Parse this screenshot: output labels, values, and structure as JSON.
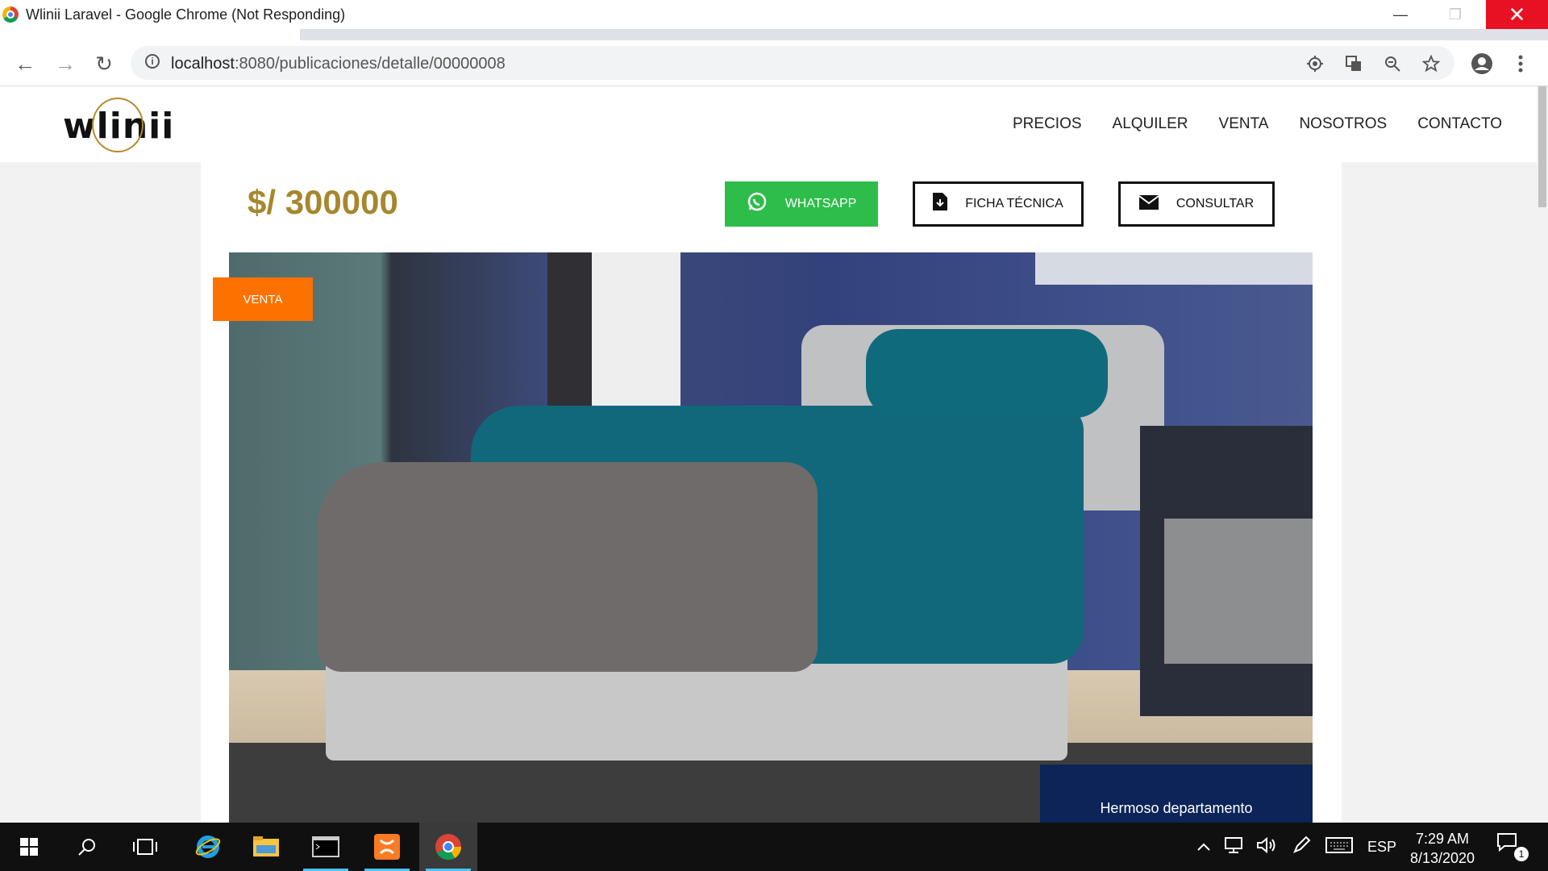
{
  "window": {
    "title": "Wlinii Laravel - Google Chrome (Not Responding)",
    "minimize_glyph": "—",
    "maximize_glyph": "❐",
    "close_glyph": "✕"
  },
  "browser": {
    "back_glyph": "←",
    "forward_glyph": "→",
    "reload_glyph": "↻",
    "info_glyph": "i",
    "url_host": "localhost",
    "url_path": ":8080/publicaciones/detalle/00000008",
    "icons": [
      "location-icon",
      "translate-icon",
      "zoom-icon",
      "star-icon",
      "profile-icon",
      "menu-icon"
    ]
  },
  "site": {
    "logo_text": "wlinii",
    "nav": [
      "PRECIOS",
      "ALQUILER",
      "VENTA",
      "NOSOTROS",
      "CONTACTO"
    ]
  },
  "listing": {
    "price": "$/ 300000",
    "buttons": {
      "whatsapp": "WHATSAPP",
      "ficha": "FICHA TÉCNICA",
      "consultar": "CONSULTAR"
    },
    "badge": "VENTA",
    "caption": "Hermoso departamento"
  },
  "taskbar": {
    "language": "ESP",
    "time": "7:29 AM",
    "date": "8/13/2020",
    "notification_count": "1"
  },
  "colors": {
    "price": "#a6872e",
    "whatsapp": "#2ebd4a",
    "badge": "#fc7100",
    "caption_bg": "#0c2457",
    "close_button": "#e81123"
  }
}
